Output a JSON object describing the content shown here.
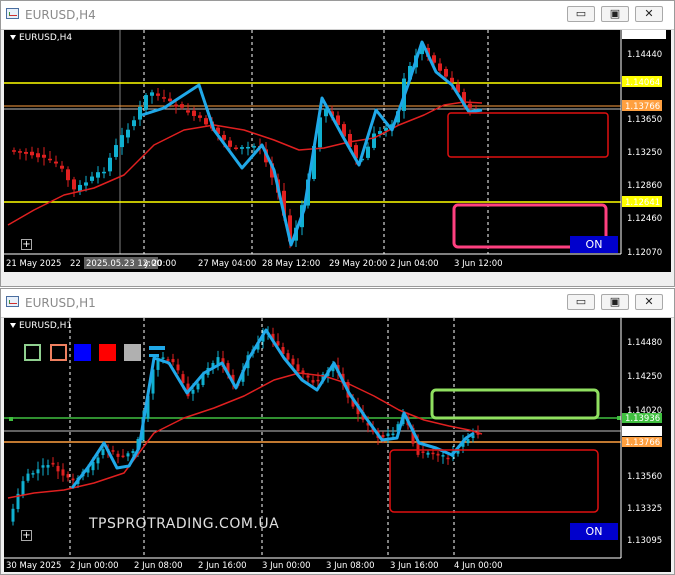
{
  "top_window": {
    "title": "EURUSD,H4",
    "symbol_label": "EURUSD,H4",
    "price_ticks": [
      "1.14634",
      "1.14440",
      "1.14064",
      "1.13766",
      "1.13650",
      "1.13250",
      "1.12860",
      "1.12641",
      "1.12460",
      "1.12070"
    ],
    "highlight_prices": {
      "yellow_high": "1.14064",
      "orange_mid": "1.13766",
      "yellow_low": "1.12641",
      "top": "1.14634"
    },
    "time_labels": [
      "21 May 2025",
      "22",
      "2025.05.23 12:00",
      "y 20:00",
      "27 May 04:00",
      "28 May 12:00",
      "29 May 20:00",
      "2 Jun 04:00",
      "3 Jun 12:00"
    ],
    "on_button": "ON"
  },
  "bottom_window": {
    "title": "EURUSD,H1",
    "symbol_label": "EURUSD,H1",
    "price_ticks": [
      "1.14480",
      "1.14250",
      "1.14020",
      "1.13936",
      "1.13821",
      "1.13766",
      "1.13560",
      "1.13325",
      "1.13095"
    ],
    "time_labels": [
      "30 May 2025",
      "2 Jun 00:00",
      "2 Jun 08:00",
      "2 Jun 16:00",
      "3 Jun 00:00",
      "3 Jun 08:00",
      "3 Jun 16:00",
      "4 Jun 00:00"
    ],
    "watermark": "TPSPROTRADING.COM.UA",
    "on_button": "ON"
  },
  "window_buttons": {
    "minimize": "▭",
    "maximize": "▣",
    "close": "✕"
  },
  "colors": {
    "bull": "#10b0d0",
    "bear": "#e02020",
    "ma": "#e02020",
    "zigzag": "#20a8e8",
    "yellow_line": "#ffff00",
    "orange_line": "#ffa040",
    "green_line": "#40c040",
    "zone_red": "#e01010",
    "zone_pink": "#ff4080",
    "zone_green": "#90e060"
  }
}
